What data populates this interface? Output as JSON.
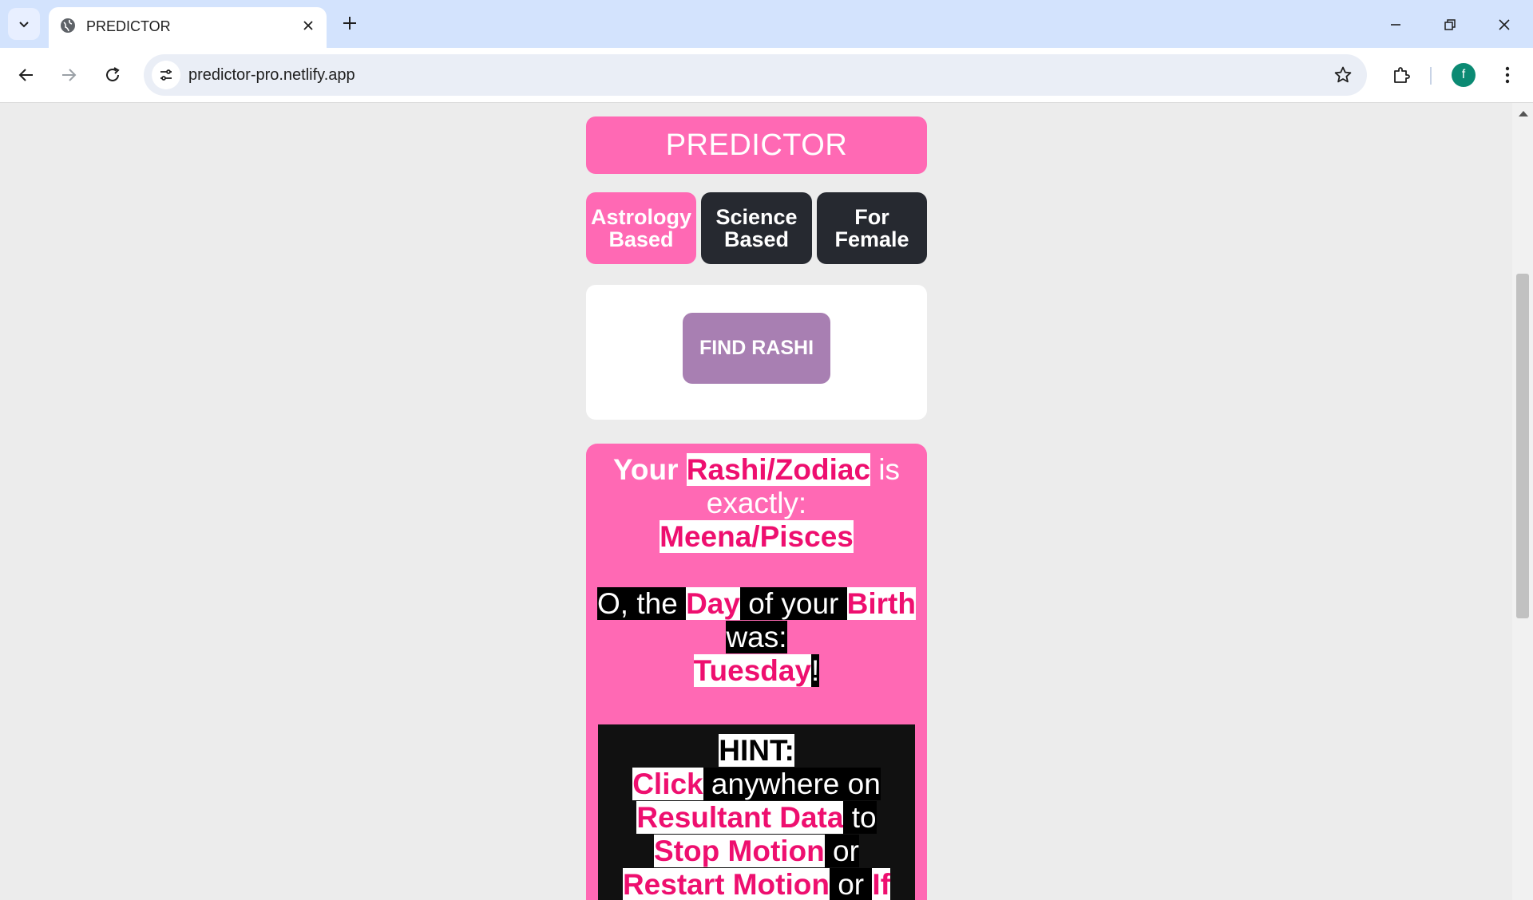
{
  "browser": {
    "tab_title": "PREDICTOR",
    "url": "predictor-pro.netlify.app",
    "profile_initial": "f"
  },
  "app": {
    "title": "PREDICTOR",
    "modes": [
      {
        "label": "Astrology\nBased",
        "active": true
      },
      {
        "label": "Science\nBased",
        "active": false
      },
      {
        "label": "For\nFemale",
        "active": false
      }
    ],
    "find_button": "FIND RASHI"
  },
  "result": {
    "line1_prefix": "Your",
    "line1_highlight": "Rashi/Zodiac",
    "line1_suffix": "is",
    "line2": "exactly:",
    "rashi": "Meena/Pisces",
    "day_prefix": "O, the",
    "day_word": "Day",
    "day_middle": "of your",
    "birth_word": "Birth",
    "was": "was:",
    "weekday": "Tuesday",
    "exclaim": "!"
  },
  "hint": {
    "title": "HINT:",
    "click": "Click",
    "anywhere_on": "anywhere on",
    "resultant_data": "Resultant Data",
    "to": "to",
    "stop_motion": "Stop Motion",
    "or1": "or",
    "restart_motion": "Restart Motion",
    "or2": "or",
    "if_word": "If"
  },
  "colors": {
    "pink": "#ff69b4",
    "dark": "#262930",
    "purple_button": "#a87fb2",
    "highlight_text": "#ee0f6f"
  }
}
